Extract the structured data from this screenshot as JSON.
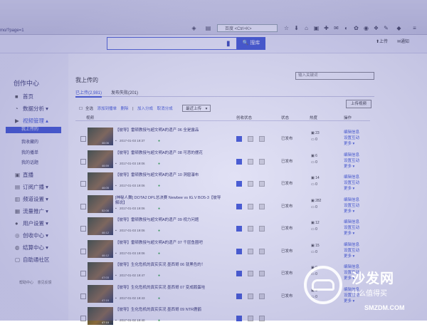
{
  "browser": {
    "url": "mo/?page=1",
    "search_engine_label": "百度 <Ctrl+K>"
  },
  "header": {
    "search_button": "搜库",
    "upload_link": "上传",
    "notify_link": "通知"
  },
  "sidebar": {
    "title": "创作中心",
    "items": [
      {
        "label": "首页",
        "icon": "home-icon"
      },
      {
        "label": "数据分析",
        "icon": "chart-icon"
      },
      {
        "label": "视频管理",
        "icon": "video-icon"
      }
    ],
    "sub_items": [
      "我上传的",
      "我收藏的",
      "我的播单",
      "我的话题"
    ],
    "items_after": [
      {
        "label": "直播",
        "icon": "live-icon"
      },
      {
        "label": "订阅广播",
        "icon": "broadcast-icon"
      },
      {
        "label": "频道设置",
        "icon": "channel-icon"
      },
      {
        "label": "流量推广",
        "icon": "traffic-icon"
      },
      {
        "label": "用户设置",
        "icon": "user-icon"
      },
      {
        "label": "创收中心",
        "icon": "money-icon"
      },
      {
        "label": "结算中心",
        "icon": "settle-icon"
      },
      {
        "label": "自助通社区",
        "icon": "community-icon"
      }
    ],
    "footer": [
      "帮助中心",
      "意见反馈"
    ]
  },
  "main": {
    "title": "我上传的",
    "filter_placeholder": "输入关键词",
    "tabs": [
      "已上传(2,981)",
      "发布失败(201)"
    ],
    "upload_video_button": "上传视频",
    "toolbar": {
      "select_all": "全选",
      "add_playlist": "添加到播单",
      "delete": "删除",
      "join_category": "加入分成",
      "cancel_category": "取消分成",
      "sort": "最近上传"
    },
    "columns": [
      "视频",
      "创收状态",
      "状态",
      "热度",
      "操作"
    ],
    "rows": [
      {
        "title": "【彼导】雷顿教授与超文明A的遗产 06 全是露品",
        "date": "2017-01-03 19:37",
        "duration": "46:06",
        "status": "已发布",
        "views": "23",
        "comments": "0",
        "actions": [
          "编辑信息",
          "设置互动",
          "更多"
        ]
      },
      {
        "title": "【彼导】雷顿教授与超文明A的遗产 08 可恶的摆花",
        "date": "2017-01-03 19:06",
        "duration": "46:59",
        "status": "已发布",
        "views": "6",
        "comments": "0",
        "actions": [
          "编辑信息",
          "设置互动",
          "更多"
        ]
      },
      {
        "title": "【彼导】雷顿教授与超文明A的遗产 10 洞窟瀑布",
        "date": "2017-01-03 19:06",
        "duration": "46:05",
        "status": "已发布",
        "views": "14",
        "comments": "0",
        "actions": [
          "编辑信息",
          "设置互动",
          "更多"
        ]
      },
      {
        "title": "[神秘人舞] DOTA2 DPL总决赛 Newbee vs IG.V BO5-3【彼导解说】",
        "date": "2017-01-03 19:06",
        "duration": "52:08",
        "status": "已发布",
        "views": "282",
        "comments": "0",
        "actions": [
          "编辑信息",
          "设置互动",
          "更多"
        ]
      },
      {
        "title": "【彼导】雷顿教授与超文明A的遗产 09 视力问题",
        "date": "2017-01-03 19:06",
        "duration": "46:12",
        "status": "已发布",
        "views": "12",
        "comments": "0",
        "actions": [
          "编辑信息",
          "设置互动",
          "更多"
        ]
      },
      {
        "title": "【彼导】雷顿教授与超文明A的遗产 07 千层鱼圈吧",
        "date": "2017-01-03 19:06",
        "duration": "46:12",
        "status": "已发布",
        "views": "15",
        "comments": "0",
        "actions": [
          "编辑信息",
          "设置互动",
          "更多"
        ]
      },
      {
        "title": "【彼导】生化危机的真实实况 墨西哥 06 就黑色的！",
        "date": "2017-01-02 19:47",
        "duration": "47:03",
        "status": "已发布",
        "views": "9",
        "comments": "0",
        "actions": [
          "编辑信息",
          "设置互动",
          "更多"
        ]
      },
      {
        "title": "【彼导】生化危机的真实实况 墨西哥 07 变成鹅蛋哇",
        "date": "2017-01-02 19:43",
        "duration": "47:19",
        "status": "已发布",
        "views": "3",
        "comments": "0",
        "actions": [
          "编辑信息",
          "设置互动",
          "更多"
        ]
      },
      {
        "title": "【彼导】生化危机的真实实况 墨西哥 09 NTR鹿鹤",
        "date": "2017-01-02 19:40",
        "duration": "47:10",
        "status": "",
        "views": "",
        "comments": "",
        "actions": []
      }
    ]
  },
  "watermark": {
    "title": "沙发网",
    "tagline": "值得买",
    "tagline_prefix": "什么",
    "url": "SMZDM.COM"
  },
  "colors": {
    "accent": "#3e56d4",
    "published_green": "#2fa83e"
  }
}
